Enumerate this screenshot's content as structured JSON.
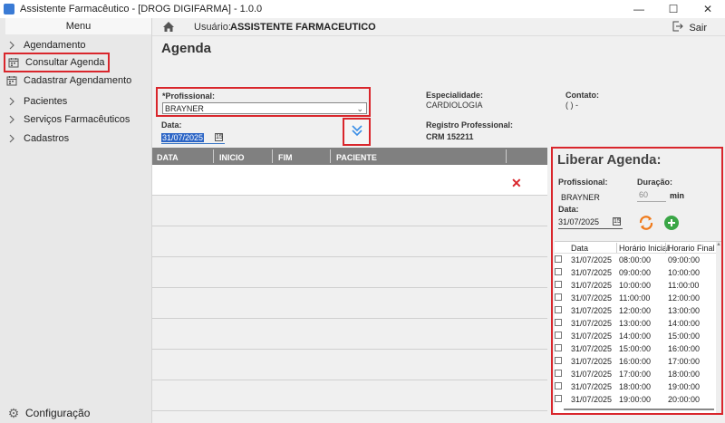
{
  "window": {
    "title": "Assistente Farmacêutico - [DROG DIGIFARMA] - 1.0.0"
  },
  "sidebar": {
    "menu_label": "Menu",
    "items": [
      {
        "label": "Agendamento"
      },
      {
        "label": "Consultar Agenda"
      },
      {
        "label": "Cadastrar Agendamento"
      },
      {
        "label": "Pacientes"
      },
      {
        "label": "Serviços Farmacêuticos"
      },
      {
        "label": "Cadastros"
      }
    ],
    "config_label": "Configuração"
  },
  "topbar": {
    "user_label": "Usuário:",
    "user_value": "ASSISTENTE FARMACEUTICO",
    "logout_label": "Sair"
  },
  "page": {
    "title": "Agenda"
  },
  "form": {
    "profissional_label": "*Profissional:",
    "profissional_value": "BRAYNER",
    "data_label": "Data:",
    "data_value": "31/07/2025",
    "especialidade_label": "Especialidade:",
    "especialidade_value": "CARDIOLOGIA",
    "registro_label": "Registro Professional:",
    "registro_value": "CRM 152211",
    "contato_label": "Contato:",
    "contato_value": "(  )  -"
  },
  "agenda_table": {
    "columns": [
      "DATA",
      "INICIO",
      "FIM",
      "PACIENTE"
    ]
  },
  "liberar": {
    "title": "Liberar Agenda:",
    "profissional_label": "Profissional:",
    "profissional_value": "BRAYNER",
    "duracao_label": "Duração:",
    "duracao_value": "60",
    "duracao_unit": "min",
    "data_label": "Data:",
    "data_value": "31/07/2025",
    "columns": [
      "Data",
      "Horário Inicial",
      "Horario Final"
    ],
    "slots": [
      {
        "date": "31/07/2025",
        "start": "08:00:00",
        "end": "09:00:00"
      },
      {
        "date": "31/07/2025",
        "start": "09:00:00",
        "end": "10:00:00"
      },
      {
        "date": "31/07/2025",
        "start": "10:00:00",
        "end": "11:00:00"
      },
      {
        "date": "31/07/2025",
        "start": "11:00:00",
        "end": "12:00:00"
      },
      {
        "date": "31/07/2025",
        "start": "12:00:00",
        "end": "13:00:00"
      },
      {
        "date": "31/07/2025",
        "start": "13:00:00",
        "end": "14:00:00"
      },
      {
        "date": "31/07/2025",
        "start": "14:00:00",
        "end": "15:00:00"
      },
      {
        "date": "31/07/2025",
        "start": "15:00:00",
        "end": "16:00:00"
      },
      {
        "date": "31/07/2025",
        "start": "16:00:00",
        "end": "17:00:00"
      },
      {
        "date": "31/07/2025",
        "start": "17:00:00",
        "end": "18:00:00"
      },
      {
        "date": "31/07/2025",
        "start": "18:00:00",
        "end": "19:00:00"
      },
      {
        "date": "31/07/2025",
        "start": "19:00:00",
        "end": "20:00:00"
      }
    ]
  }
}
